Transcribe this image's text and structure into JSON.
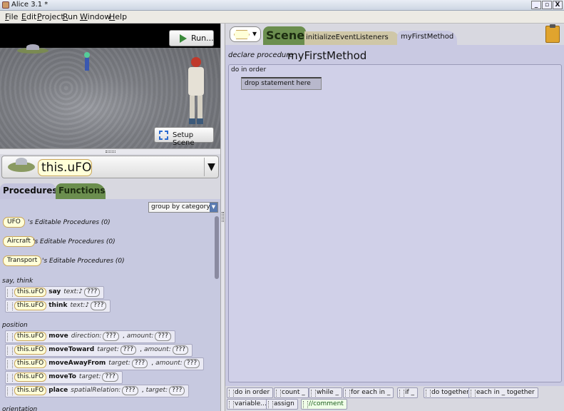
{
  "window": {
    "title": "Alice 3.1  *",
    "controls": [
      "_",
      "▫",
      "X"
    ]
  },
  "menu": [
    "File",
    "Edit",
    "Project",
    "Run",
    "Window",
    "Help"
  ],
  "scene_view": {
    "run_label": "Run...",
    "setup_label": "Setup Scene"
  },
  "selector": {
    "instance": "this.uFO",
    "dropdown": "▼"
  },
  "left_tabs": {
    "procedures": "Procedures",
    "functions": "Functions"
  },
  "group_by": "group by category",
  "editable_types": [
    {
      "chip": "UFO",
      "desc": "'s Editable Procedures (0)"
    },
    {
      "chip": "Aircraft",
      "desc": "'s Editable Procedures (0)"
    },
    {
      "chip": "Transport",
      "desc": "'s Editable Procedures (0)"
    }
  ],
  "categories": {
    "say_think": "say, think",
    "position": "position",
    "orientation": "orientation"
  },
  "say_think": [
    {
      "obj": "this.uFO",
      "name": "say",
      "param": "text:",
      "icon": "♪",
      "val": "???"
    },
    {
      "obj": "this.uFO",
      "name": "think",
      "param": "text:",
      "icon": "♪",
      "val": "???"
    }
  ],
  "position": [
    {
      "obj": "this.uFO",
      "name": "move",
      "p1": "direction:",
      "v1": "???",
      "p2": "amount:",
      "v2": "???"
    },
    {
      "obj": "this.uFO",
      "name": "moveToward",
      "p1": "target:",
      "v1": "???",
      "p2": "amount:",
      "v2": "???"
    },
    {
      "obj": "this.uFO",
      "name": "moveAwayFrom",
      "p1": "target:",
      "v1": "???",
      "p2": "amount:",
      "v2": "???"
    },
    {
      "obj": "this.uFO",
      "name": "moveTo",
      "p1": "target:",
      "v1": "???"
    },
    {
      "obj": "this.uFO",
      "name": "place",
      "p1": "spatialRelation:",
      "v1": "???",
      "p2": "target:",
      "v2": "???"
    }
  ],
  "editor_tabs": {
    "scene": "Scene",
    "init": "initializeEventListeners",
    "method": "myFirstMethod"
  },
  "editor": {
    "declare": "declare procedure",
    "method_name": "myFirstMethod",
    "do_in_order": "do in order",
    "drop_hint": "drop statement here"
  },
  "control_blocks": {
    "row1": [
      "do in order",
      "count _",
      "while _",
      "for each in _",
      "if _",
      "do together",
      "each in _ together"
    ],
    "row2": [
      "variable...",
      "assign",
      "//comment"
    ]
  }
}
